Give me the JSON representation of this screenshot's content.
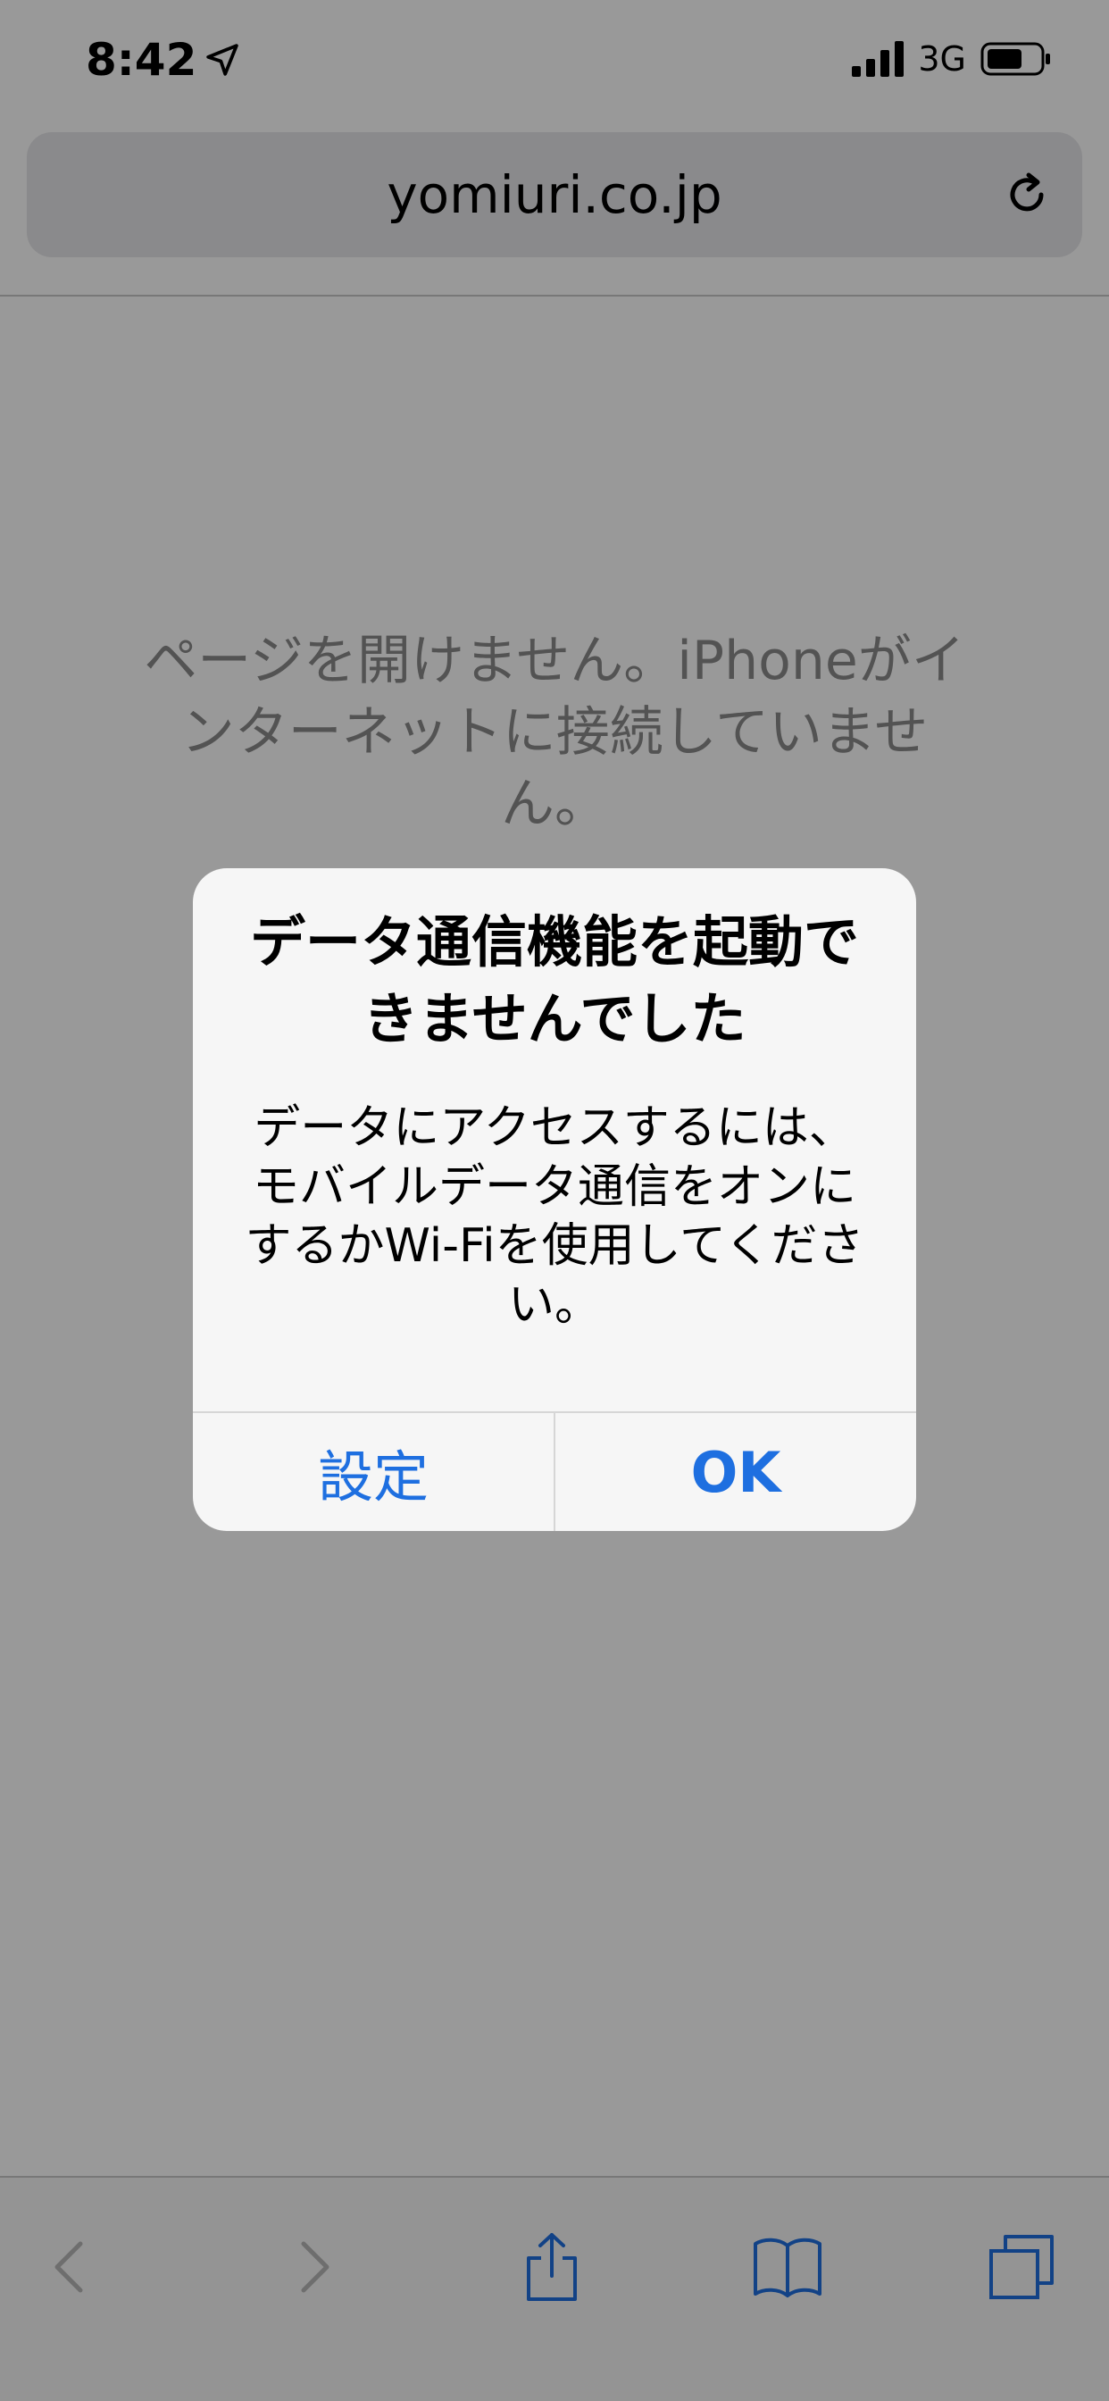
{
  "status_bar": {
    "time": "8:42",
    "network": "3G"
  },
  "url_bar": {
    "domain": "yomiuri.co.jp"
  },
  "page": {
    "error_message": "ページを開けません。iPhoneがインターネットに接続していません。"
  },
  "alert": {
    "title": "データ通信機能を起動できませんでした",
    "message": "データにアクセスするには、モバイルデータ通信をオンにするかWi-Fiを使用してください。",
    "buttons": {
      "settings": "設定",
      "ok": "OK"
    }
  },
  "colors": {
    "accent": "#1e6fe0",
    "toolbar_icon": "#1e6fe0",
    "toolbar_icon_disabled": "#b8b8b8"
  }
}
